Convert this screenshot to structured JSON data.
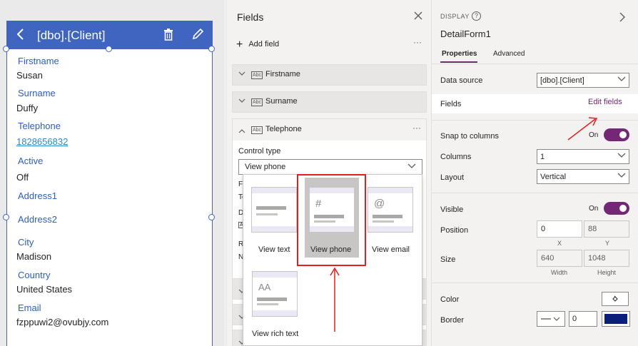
{
  "form_preview": {
    "title": "[dbo].[Client]",
    "back_icon": "chevron-left-icon",
    "delete_icon": "trash-icon",
    "edit_icon": "pencil-icon",
    "fields": [
      {
        "label": "Firstname",
        "value": "Susan"
      },
      {
        "label": "Surname",
        "value": "Duffy"
      },
      {
        "label": "Telephone",
        "value": "1828656832"
      },
      {
        "label": "Active",
        "value": "Off"
      },
      {
        "label": "Address1",
        "value": ""
      },
      {
        "label": "Address2",
        "value": ""
      },
      {
        "label": "City",
        "value": "Madison"
      },
      {
        "label": "Country",
        "value": "United States"
      },
      {
        "label": "Email",
        "value": "fzppuwi2@ovubjy.com"
      }
    ]
  },
  "fields_panel": {
    "title": "Fields",
    "close_icon": "close-icon",
    "add_field": "Add field",
    "more": "···",
    "rows": [
      "Firstname",
      "Surname",
      "Telephone"
    ],
    "abc_badge": "Abc",
    "control_type_label": "Control type",
    "control_type_value": "View phone",
    "hidden_labels": [
      "Fi",
      "Te",
      "D",
      "A",
      "R",
      "N"
    ],
    "options": [
      {
        "label": "View text",
        "icon": "text-card-icon"
      },
      {
        "label": "View phone",
        "icon": "hash-icon",
        "glyph": "#"
      },
      {
        "label": "View email",
        "icon": "at-icon",
        "glyph": "@"
      },
      {
        "label": "View rich text",
        "icon": "rich-text-icon",
        "glyph": "AA"
      }
    ]
  },
  "properties": {
    "section": "DISPLAY",
    "name": "DetailForm1",
    "tabs": [
      "Properties",
      "Advanced"
    ],
    "data_source_label": "Data source",
    "data_source_value": "[dbo].[Client]",
    "fields_label": "Fields",
    "edit_fields": "Edit fields",
    "snap_label": "Snap to columns",
    "snap_state": "On",
    "columns_label": "Columns",
    "columns_value": "1",
    "layout_label": "Layout",
    "layout_value": "Vertical",
    "visible_label": "Visible",
    "visible_state": "On",
    "position_label": "Position",
    "position_x": "0",
    "position_y": "88",
    "x_label": "X",
    "y_label": "Y",
    "size_label": "Size",
    "width_value": "640",
    "height_value": "1048",
    "width_label": "Width",
    "height_label": "Height",
    "color_label": "Color",
    "border_label": "Border",
    "border_width": "0",
    "accent": "#742774",
    "border_color": "#0b1e7a",
    "annotation_color": "#e02020"
  }
}
